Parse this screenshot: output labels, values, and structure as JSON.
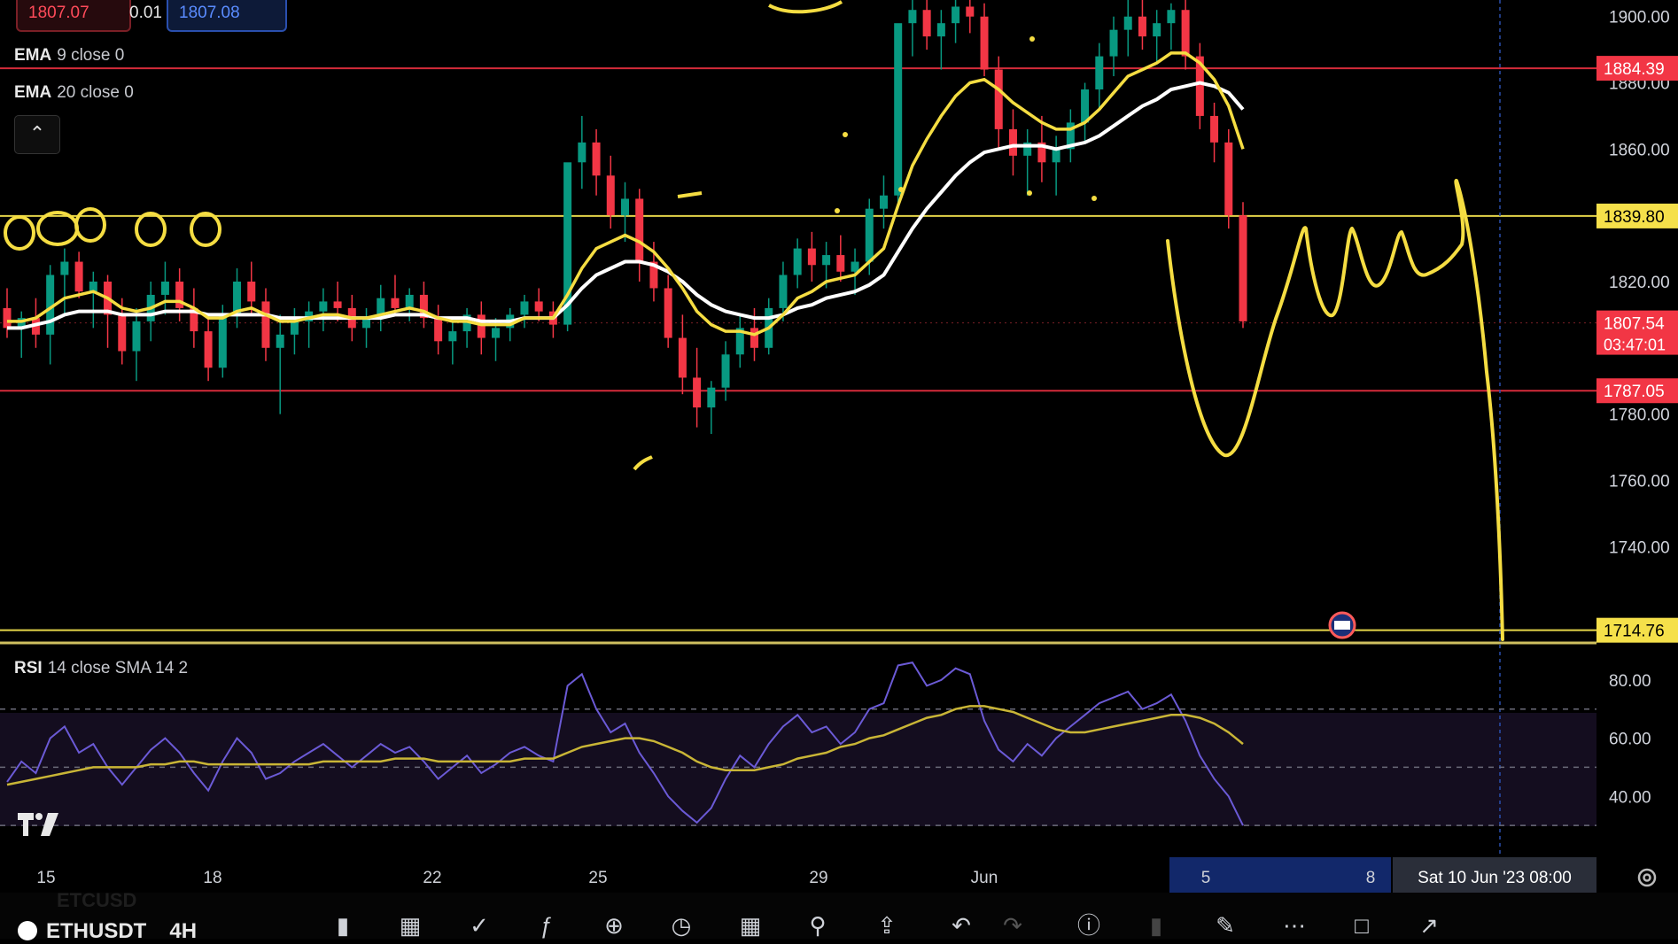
{
  "symbol": {
    "name": "ETHUSDT",
    "timeframe": "4H",
    "ghost_text": "ETCUSD"
  },
  "trade": {
    "sell_price": "1807.07",
    "spread": "0.01",
    "buy_price": "1807.08"
  },
  "indicators": {
    "ema9": {
      "name": "EMA",
      "params": "9 close 0",
      "color": "#f5dd42"
    },
    "ema20": {
      "name": "EMA",
      "params": "20 close 0",
      "color": "#ffffff"
    },
    "rsi": {
      "name": "RSI",
      "params": "14 close SMA 14 2",
      "line_color": "#6b5ad6",
      "sma_color": "#c9b536"
    }
  },
  "price_axis": {
    "labels": [
      "1900.00",
      "1880.00",
      "1860.00",
      "1820.00",
      "1780.00",
      "1760.00",
      "1740.00"
    ],
    "tags": [
      {
        "price": "1884.39",
        "color": "#f23645"
      },
      {
        "price": "1839.80",
        "color": "#f5e04a"
      },
      {
        "price": "1807.54",
        "countdown": "03:47:01",
        "color": "#f23645"
      },
      {
        "price": "1787.05",
        "color": "#f23645"
      },
      {
        "price": "1714.76",
        "color": "#f5e04a"
      }
    ]
  },
  "rsi_axis": {
    "labels": [
      "80.00",
      "60.00",
      "40.00"
    ]
  },
  "time_axis": {
    "labels": [
      "15",
      "18",
      "22",
      "25",
      "29",
      "Jun",
      "5",
      "8"
    ],
    "crosshair_label": "Sat 10 Jun '23   08:00"
  },
  "colors": {
    "up": "#089981",
    "down": "#f23645",
    "drawing": "#f5dd42",
    "background": "#000000"
  },
  "chart_data": {
    "type": "candlestick",
    "symbol": "ETHUSDT",
    "timeframe": "4H",
    "price_range": [
      1712,
      1905
    ],
    "horizontal_levels": [
      1884.39,
      1839.8,
      1787.05,
      1714.76
    ],
    "last_price": 1807.54,
    "rsi_range": [
      20,
      90
    ],
    "rsi_levels": [
      70,
      50,
      30
    ],
    "candles": [
      [
        1812,
        1818,
        1803,
        1806
      ],
      [
        1806,
        1811,
        1797,
        1809
      ],
      [
        1809,
        1815,
        1800,
        1804
      ],
      [
        1804,
        1825,
        1795,
        1822
      ],
      [
        1822,
        1830,
        1810,
        1826
      ],
      [
        1826,
        1829,
        1815,
        1817
      ],
      [
        1817,
        1823,
        1806,
        1820
      ],
      [
        1820,
        1822,
        1800,
        1810
      ],
      [
        1810,
        1815,
        1795,
        1799
      ],
      [
        1799,
        1812,
        1790,
        1808
      ],
      [
        1808,
        1820,
        1802,
        1816
      ],
      [
        1816,
        1826,
        1810,
        1820
      ],
      [
        1820,
        1824,
        1808,
        1812
      ],
      [
        1812,
        1818,
        1800,
        1805
      ],
      [
        1805,
        1810,
        1790,
        1794
      ],
      [
        1794,
        1813,
        1791,
        1810
      ],
      [
        1810,
        1824,
        1806,
        1820
      ],
      [
        1820,
        1826,
        1810,
        1814
      ],
      [
        1814,
        1818,
        1796,
        1800
      ],
      [
        1800,
        1810,
        1780,
        1804
      ],
      [
        1804,
        1812,
        1798,
        1808
      ],
      [
        1808,
        1814,
        1800,
        1811
      ],
      [
        1811,
        1818,
        1805,
        1814
      ],
      [
        1814,
        1820,
        1808,
        1812
      ],
      [
        1812,
        1816,
        1802,
        1806
      ],
      [
        1806,
        1812,
        1800,
        1809
      ],
      [
        1809,
        1819,
        1805,
        1815
      ],
      [
        1815,
        1822,
        1810,
        1812
      ],
      [
        1812,
        1818,
        1808,
        1816
      ],
      [
        1816,
        1820,
        1806,
        1809
      ],
      [
        1809,
        1813,
        1798,
        1802
      ],
      [
        1802,
        1808,
        1795,
        1805
      ],
      [
        1805,
        1812,
        1800,
        1810
      ],
      [
        1810,
        1814,
        1798,
        1803
      ],
      [
        1803,
        1809,
        1796,
        1806
      ],
      [
        1806,
        1812,
        1802,
        1810
      ],
      [
        1810,
        1816,
        1806,
        1814
      ],
      [
        1814,
        1818,
        1808,
        1811
      ],
      [
        1811,
        1814,
        1803,
        1807
      ],
      [
        1807,
        1830,
        1805,
        1856
      ],
      [
        1856,
        1870,
        1848,
        1862
      ],
      [
        1862,
        1866,
        1846,
        1852
      ],
      [
        1852,
        1858,
        1836,
        1840
      ],
      [
        1840,
        1850,
        1832,
        1845
      ],
      [
        1845,
        1848,
        1820,
        1826
      ],
      [
        1826,
        1832,
        1814,
        1818
      ],
      [
        1818,
        1822,
        1800,
        1803
      ],
      [
        1803,
        1810,
        1786,
        1791
      ],
      [
        1791,
        1800,
        1776,
        1782
      ],
      [
        1782,
        1790,
        1774,
        1788
      ],
      [
        1788,
        1802,
        1784,
        1798
      ],
      [
        1798,
        1810,
        1794,
        1806
      ],
      [
        1806,
        1812,
        1796,
        1800
      ],
      [
        1800,
        1815,
        1798,
        1812
      ],
      [
        1812,
        1826,
        1808,
        1822
      ],
      [
        1822,
        1833,
        1818,
        1830
      ],
      [
        1830,
        1835,
        1820,
        1825
      ],
      [
        1825,
        1832,
        1818,
        1828
      ],
      [
        1828,
        1834,
        1820,
        1823
      ],
      [
        1823,
        1830,
        1816,
        1826
      ],
      [
        1826,
        1845,
        1822,
        1842
      ],
      [
        1842,
        1852,
        1836,
        1846
      ],
      [
        1846,
        1880,
        1842,
        1898
      ],
      [
        1898,
        1910,
        1888,
        1902
      ],
      [
        1902,
        1908,
        1890,
        1894
      ],
      [
        1894,
        1902,
        1884,
        1898
      ],
      [
        1898,
        1906,
        1892,
        1903
      ],
      [
        1903,
        1910,
        1895,
        1900
      ],
      [
        1900,
        1904,
        1882,
        1884
      ],
      [
        1884,
        1888,
        1860,
        1866
      ],
      [
        1866,
        1872,
        1852,
        1858
      ],
      [
        1858,
        1866,
        1846,
        1862
      ],
      [
        1862,
        1870,
        1850,
        1856
      ],
      [
        1856,
        1864,
        1846,
        1860
      ],
      [
        1860,
        1872,
        1856,
        1868
      ],
      [
        1868,
        1880,
        1862,
        1878
      ],
      [
        1878,
        1892,
        1872,
        1888
      ],
      [
        1888,
        1900,
        1882,
        1896
      ],
      [
        1896,
        1905,
        1888,
        1900
      ],
      [
        1900,
        1906,
        1890,
        1894
      ],
      [
        1894,
        1902,
        1886,
        1898
      ],
      [
        1898,
        1904,
        1890,
        1902
      ],
      [
        1902,
        1906,
        1884,
        1888
      ],
      [
        1888,
        1892,
        1866,
        1870
      ],
      [
        1870,
        1874,
        1856,
        1862
      ],
      [
        1862,
        1866,
        1836,
        1840
      ],
      [
        1840,
        1844,
        1806,
        1808
      ]
    ],
    "ema9": [
      1808,
      1808,
      1809,
      1812,
      1815,
      1816,
      1817,
      1815,
      1812,
      1811,
      1812,
      1814,
      1814,
      1812,
      1809,
      1809,
      1811,
      1812,
      1810,
      1808,
      1808,
      1809,
      1810,
      1810,
      1809,
      1809,
      1810,
      1811,
      1812,
      1811,
      1809,
      1808,
      1808,
      1807,
      1807,
      1807,
      1809,
      1809,
      1809,
      1816,
      1824,
      1830,
      1832,
      1834,
      1832,
      1829,
      1824,
      1818,
      1811,
      1807,
      1805,
      1805,
      1804,
      1806,
      1810,
      1815,
      1817,
      1820,
      1821,
      1822,
      1826,
      1830,
      1843,
      1855,
      1863,
      1870,
      1876,
      1880,
      1881,
      1878,
      1874,
      1871,
      1868,
      1866,
      1866,
      1868,
      1872,
      1877,
      1882,
      1884,
      1886,
      1889,
      1889,
      1886,
      1881,
      1873,
      1860
    ],
    "ema20": [
      1806,
      1806,
      1807,
      1808,
      1810,
      1811,
      1811,
      1811,
      1810,
      1810,
      1810,
      1811,
      1811,
      1811,
      1810,
      1810,
      1810,
      1810,
      1810,
      1809,
      1809,
      1809,
      1809,
      1809,
      1809,
      1809,
      1809,
      1810,
      1810,
      1810,
      1809,
      1809,
      1809,
      1808,
      1808,
      1808,
      1809,
      1809,
      1809,
      1813,
      1818,
      1822,
      1824,
      1826,
      1826,
      1825,
      1823,
      1820,
      1816,
      1813,
      1811,
      1810,
      1809,
      1809,
      1810,
      1812,
      1813,
      1815,
      1816,
      1817,
      1819,
      1822,
      1829,
      1836,
      1842,
      1847,
      1852,
      1856,
      1859,
      1860,
      1861,
      1861,
      1861,
      1860,
      1861,
      1862,
      1864,
      1867,
      1870,
      1873,
      1875,
      1878,
      1879,
      1880,
      1879,
      1877,
      1872
    ],
    "rsi": [
      45,
      52,
      48,
      60,
      64,
      55,
      58,
      50,
      44,
      50,
      56,
      60,
      55,
      48,
      42,
      52,
      60,
      55,
      46,
      48,
      52,
      55,
      58,
      54,
      50,
      54,
      58,
      55,
      57,
      52,
      46,
      50,
      54,
      48,
      51,
      55,
      57,
      54,
      52,
      78,
      82,
      70,
      62,
      65,
      55,
      48,
      40,
      35,
      31,
      36,
      46,
      54,
      50,
      58,
      64,
      68,
      62,
      64,
      58,
      62,
      70,
      72,
      85,
      86,
      78,
      80,
      84,
      82,
      66,
      56,
      52,
      58,
      54,
      60,
      64,
      68,
      72,
      74,
      76,
      70,
      72,
      75,
      66,
      54,
      46,
      40,
      30
    ],
    "rsi_sma": [
      44,
      45,
      46,
      47,
      48,
      49,
      50,
      50,
      50,
      50,
      51,
      51,
      52,
      52,
      51,
      51,
      51,
      51,
      51,
      51,
      51,
      51,
      52,
      52,
      52,
      52,
      52,
      53,
      53,
      53,
      52,
      52,
      52,
      52,
      52,
      52,
      53,
      53,
      53,
      55,
      57,
      58,
      59,
      60,
      60,
      59,
      57,
      55,
      52,
      50,
      49,
      49,
      49,
      50,
      51,
      53,
      54,
      55,
      57,
      58,
      60,
      61,
      63,
      65,
      67,
      68,
      70,
      71,
      71,
      70,
      69,
      67,
      65,
      63,
      62,
      62,
      63,
      64,
      65,
      66,
      67,
      68,
      68,
      67,
      65,
      62,
      58
    ]
  }
}
